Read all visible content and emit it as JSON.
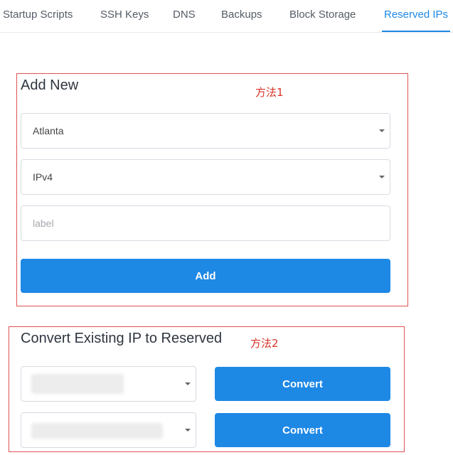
{
  "tabs": [
    {
      "label": "Startup Scripts",
      "active": false
    },
    {
      "label": "SSH Keys",
      "active": false
    },
    {
      "label": "DNS",
      "active": false
    },
    {
      "label": "Backups",
      "active": false
    },
    {
      "label": "Block Storage",
      "active": false
    },
    {
      "label": "Reserved IPs",
      "active": true
    }
  ],
  "add_new": {
    "title": "Add New",
    "annotation": "方法1",
    "location_select": "Atlanta",
    "ip_type_select": "IPv4",
    "label_placeholder": "label",
    "add_button": "Add"
  },
  "convert": {
    "title": "Convert Existing IP to Reserved",
    "annotation": "方法2",
    "rows": [
      {
        "convert_button": "Convert"
      },
      {
        "convert_button": "Convert"
      }
    ]
  },
  "colors": {
    "accent": "#1e88e5",
    "annotation": "#d9342b",
    "frame": "#e05252"
  }
}
